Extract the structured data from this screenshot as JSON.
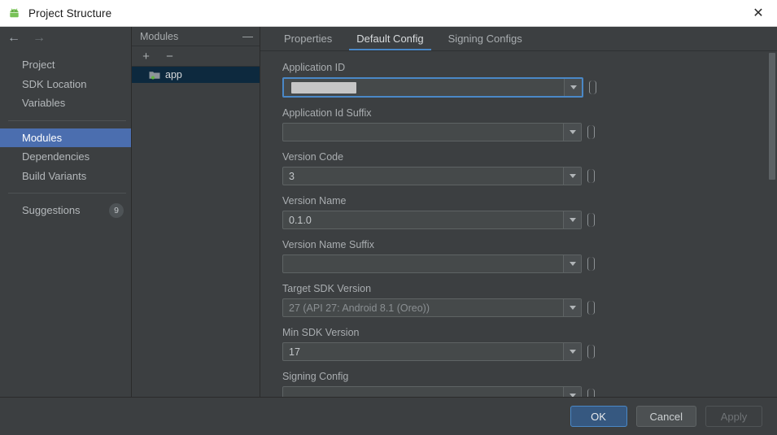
{
  "window": {
    "title": "Project Structure",
    "icon": "android-icon",
    "close_label": "✕"
  },
  "nav": {
    "back_label": "←",
    "forward_label": "→"
  },
  "sidebar": {
    "items": [
      {
        "label": "Project",
        "selected": false,
        "badge": ""
      },
      {
        "label": "SDK Location",
        "selected": false,
        "badge": ""
      },
      {
        "label": "Variables",
        "selected": false,
        "badge": ""
      },
      {
        "label": "Modules",
        "selected": true,
        "badge": ""
      },
      {
        "label": "Dependencies",
        "selected": false,
        "badge": ""
      },
      {
        "label": "Build Variants",
        "selected": false,
        "badge": ""
      },
      {
        "label": "Suggestions",
        "selected": false,
        "badge": "9"
      }
    ]
  },
  "modules_panel": {
    "title": "Modules",
    "collapse_label": "—",
    "add_label": "+",
    "remove_label": "−",
    "rows": [
      {
        "label": "app",
        "selected": true,
        "icon": "module-folder-icon"
      }
    ]
  },
  "tabs": [
    {
      "label": "Properties",
      "active": false
    },
    {
      "label": "Default Config",
      "active": true
    },
    {
      "label": "Signing Configs",
      "active": false
    }
  ],
  "form": {
    "fields": [
      {
        "label": "Application ID",
        "value": "",
        "placeholder": "",
        "redacted": true,
        "focused": true,
        "dim": false
      },
      {
        "label": "Application Id Suffix",
        "value": "",
        "placeholder": "",
        "redacted": false,
        "focused": false,
        "dim": false
      },
      {
        "label": "Version Code",
        "value": "3",
        "placeholder": "",
        "redacted": false,
        "focused": false,
        "dim": false
      },
      {
        "label": "Version Name",
        "value": "0.1.0",
        "placeholder": "",
        "redacted": false,
        "focused": false,
        "dim": false
      },
      {
        "label": "Version Name Suffix",
        "value": "",
        "placeholder": "",
        "redacted": false,
        "focused": false,
        "dim": false
      },
      {
        "label": "Target SDK Version",
        "value": "27 (API 27: Android 8.1 (Oreo))",
        "placeholder": "",
        "redacted": false,
        "focused": false,
        "dim": true
      },
      {
        "label": "Min SDK Version",
        "value": "17",
        "placeholder": "",
        "redacted": false,
        "focused": false,
        "dim": false
      },
      {
        "label": "Signing Config",
        "value": "",
        "placeholder": "",
        "redacted": false,
        "focused": false,
        "dim": false
      }
    ]
  },
  "footer": {
    "ok_label": "OK",
    "cancel_label": "Cancel",
    "apply_label": "Apply"
  },
  "colors": {
    "accent_blue": "#4a88c7",
    "selection_blue": "#4b6eaf",
    "primary_button": "#365880",
    "background": "#3c3f41",
    "field_background": "#45494a",
    "module_selected": "#0d293e",
    "android_green": "#78c257"
  }
}
